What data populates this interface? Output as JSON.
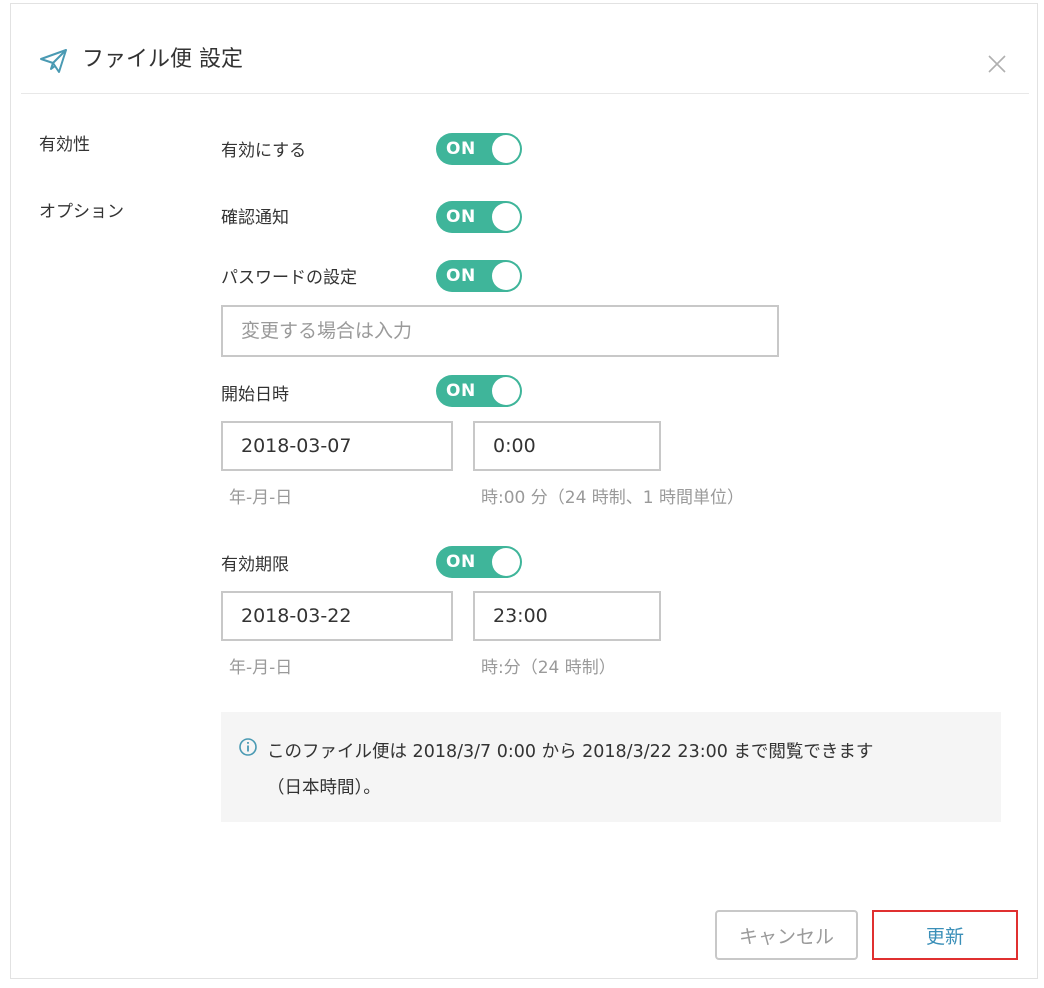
{
  "header": {
    "title": "ファイル便 設定",
    "icon": "paper-plane-icon",
    "close_icon": "close-icon",
    "accent_color": "#4a9ab3"
  },
  "sections": {
    "validity_label": "有効性",
    "options_label": "オプション"
  },
  "rows": {
    "enable": {
      "label": "有効にする",
      "toggle": "ON"
    },
    "confirm_notify": {
      "label": "確認通知",
      "toggle": "ON"
    },
    "password": {
      "label": "パスワードの設定",
      "toggle": "ON",
      "placeholder": "変更する場合は入力",
      "value": ""
    },
    "start": {
      "label": "開始日時",
      "toggle": "ON",
      "date_value": "2018-03-07",
      "time_value": "0:00",
      "date_hint": "年-月-日",
      "time_hint": "時:00 分（24 時制、1 時間単位）"
    },
    "expire": {
      "label": "有効期限",
      "toggle": "ON",
      "date_value": "2018-03-22",
      "time_value": "23:00",
      "date_hint": "年-月-日",
      "time_hint": "時:分（24 時制）"
    }
  },
  "info": {
    "icon": "info-icon",
    "line1": "このファイル便は 2018/3/7 0:00 から 2018/3/22 23:00 まで閲覧できます",
    "line2": "（日本時間）。"
  },
  "footer": {
    "cancel_label": "キャンセル",
    "update_label": "更新"
  },
  "colors": {
    "toggle_on": "#3fb59a",
    "info_bg": "#f5f5f5",
    "highlight_border": "#e03030",
    "update_text": "#3a8fb8"
  }
}
